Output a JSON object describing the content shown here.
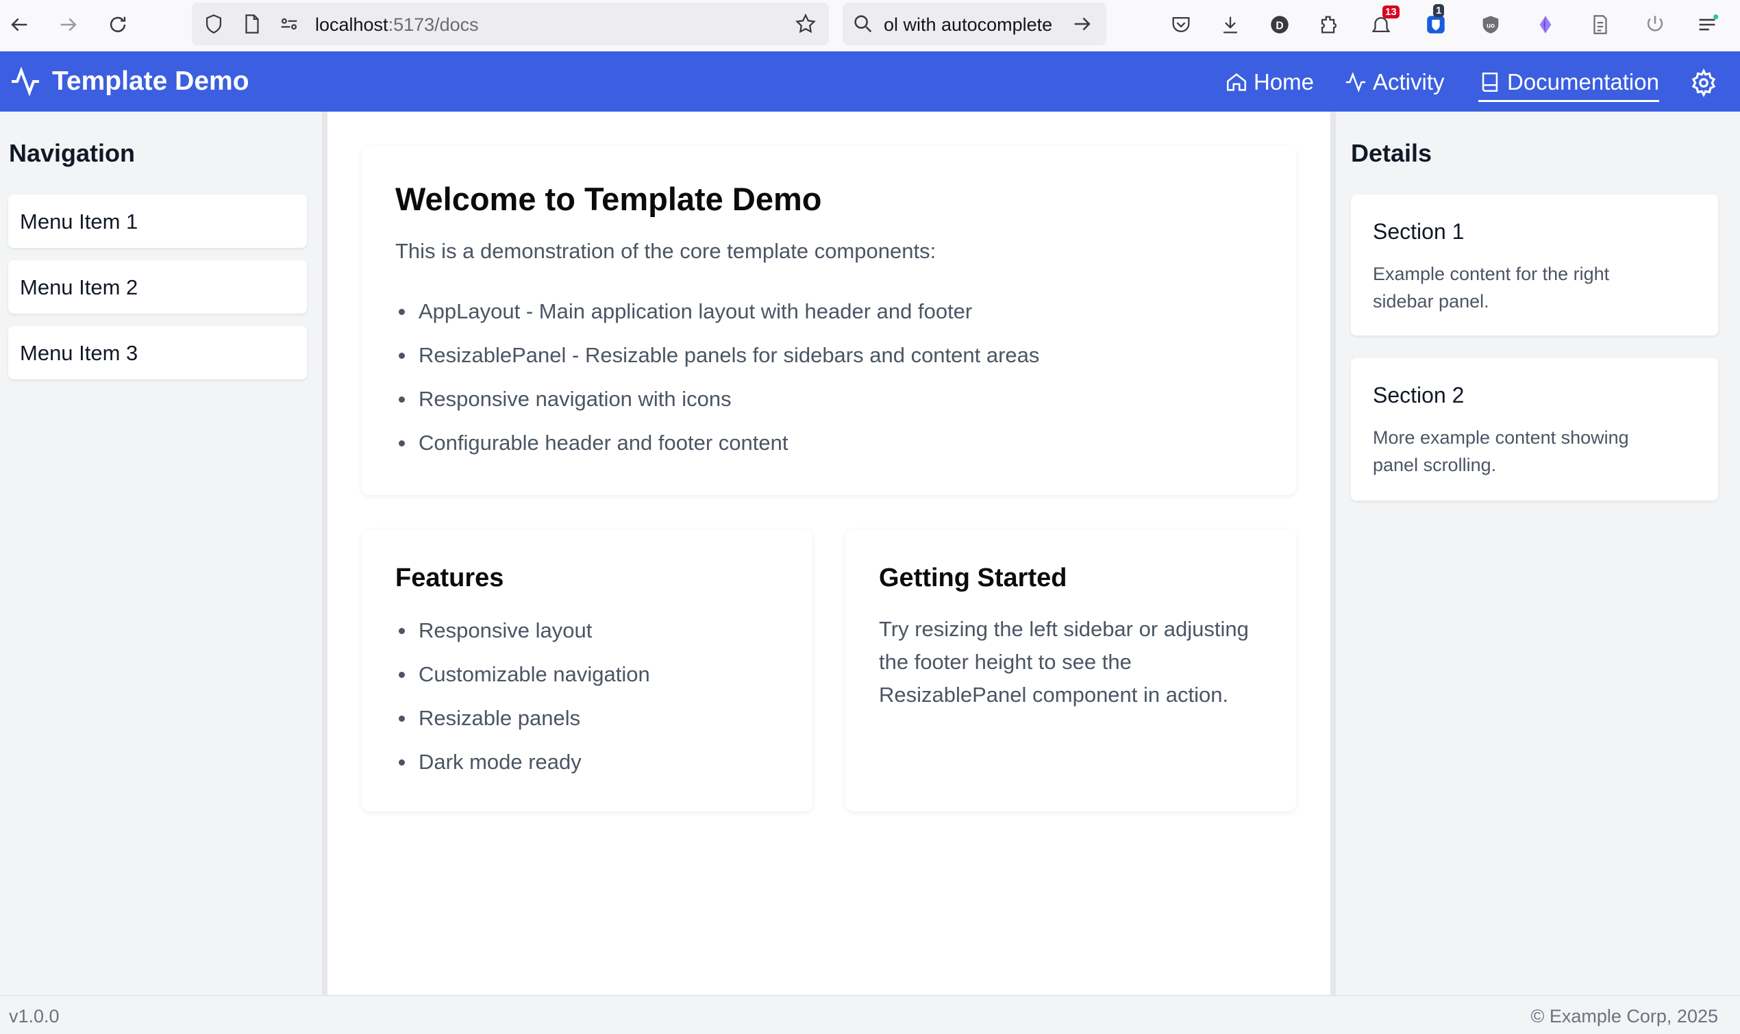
{
  "browser": {
    "url_host": "localhost",
    "url_path": ":5173/docs",
    "search_text": "ol with autocomplete",
    "badges": {
      "notifications": "13",
      "extension": "1"
    }
  },
  "header": {
    "brand": "Template Demo",
    "nav": [
      {
        "label": "Home",
        "icon": "home-icon"
      },
      {
        "label": "Activity",
        "icon": "activity-icon"
      },
      {
        "label": "Documentation",
        "icon": "book-icon",
        "active": true
      }
    ],
    "accent_color": "#3b5fe0"
  },
  "left_sidebar": {
    "title": "Navigation",
    "items": [
      "Menu Item 1",
      "Menu Item 2",
      "Menu Item 3"
    ]
  },
  "main": {
    "welcome": {
      "title": "Welcome to Template Demo",
      "intro": "This is a demonstration of the core template components:",
      "bullets": [
        "AppLayout - Main application layout with header and footer",
        "ResizablePanel - Resizable panels for sidebars and content areas",
        "Responsive navigation with icons",
        "Configurable header and footer content"
      ]
    },
    "features": {
      "title": "Features",
      "bullets": [
        "Responsive layout",
        "Customizable navigation",
        "Resizable panels",
        "Dark mode ready"
      ]
    },
    "getting_started": {
      "title": "Getting Started",
      "text": "Try resizing the left sidebar or adjusting the footer height to see the ResizablePanel component in action."
    }
  },
  "right_sidebar": {
    "title": "Details",
    "sections": [
      {
        "title": "Section 1",
        "text": "Example content for the right sidebar panel."
      },
      {
        "title": "Section 2",
        "text": "More example content showing panel scrolling."
      }
    ]
  },
  "footer": {
    "version": "v1.0.0",
    "copyright": "© Example Corp, 2025"
  }
}
